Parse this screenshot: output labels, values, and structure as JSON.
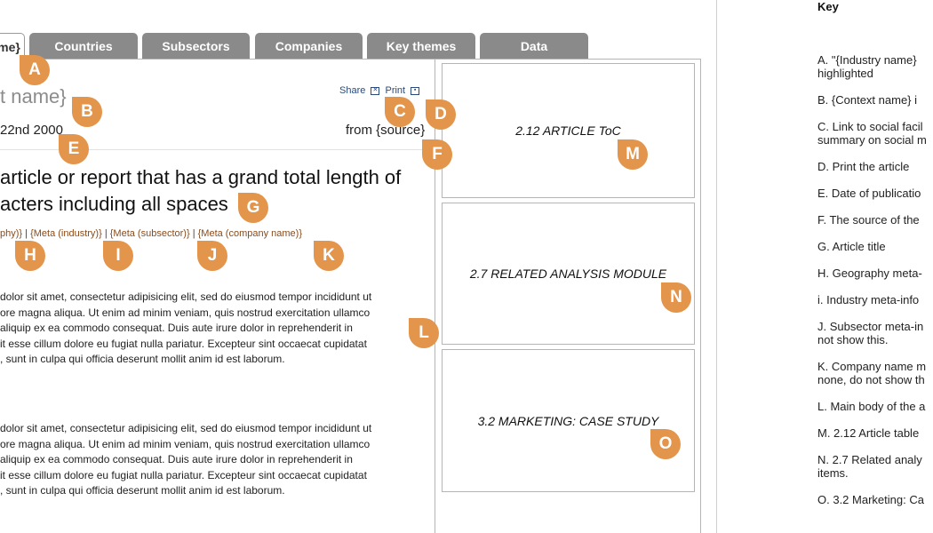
{
  "tabs": [
    {
      "label": "me}",
      "active": true
    },
    {
      "label": "Countries",
      "active": false
    },
    {
      "label": "Subsectors",
      "active": false
    },
    {
      "label": "Companies",
      "active": false
    },
    {
      "label": "Key themes",
      "active": false
    },
    {
      "label": "Data",
      "active": false
    }
  ],
  "article": {
    "context_name": "t name}",
    "date": "22nd 2000",
    "source": "from {source}",
    "share_label": "Share",
    "print_label": "Print",
    "title_lines": [
      "article or report that has a grand total length of",
      "acters including all spaces"
    ],
    "meta": {
      "geography": "phy)}",
      "industry": "{Meta (industry)}",
      "subsector": "{Meta (subsector)}",
      "company": "{Meta (company name)}",
      "separator": "|"
    },
    "paragraphs": [
      [
        "dolor sit amet, consectetur adipisicing elit, sed do eiusmod tempor incididunt ut",
        "ore magna aliqua. Ut enim ad minim veniam, quis nostrud exercitation ullamco",
        "aliquip ex ea commodo consequat. Duis aute irure dolor in reprehenderit in",
        "it esse cillum dolore eu fugiat nulla pariatur. Excepteur sint occaecat cupidatat",
        ", sunt in culpa qui officia deserunt mollit anim id est laborum."
      ],
      [
        "dolor sit amet, consectetur adipisicing elit, sed do eiusmod tempor incididunt ut",
        "ore magna aliqua. Ut enim ad minim veniam, quis nostrud exercitation ullamco",
        "aliquip ex ea commodo consequat. Duis aute irure dolor in reprehenderit in",
        "it esse cillum dolore eu fugiat nulla pariatur. Excepteur sint occaecat cupidatat",
        ", sunt in culpa qui officia deserunt mollit anim id est laborum."
      ]
    ]
  },
  "modules": {
    "toc": "2.12 ARTICLE ToC",
    "related": "2.7 RELATED ANALYSIS MODULE",
    "marketing": "3.2 MARKETING: CASE STUDY"
  },
  "markers": {
    "A": "A",
    "B": "B",
    "C": "C",
    "D": "D",
    "E": "E",
    "F": "F",
    "G": "G",
    "H": "H",
    "I": "I",
    "J": "J",
    "K": "K",
    "L": "L",
    "M": "M",
    "N": "N",
    "O": "O"
  },
  "key": {
    "heading": "Key",
    "items": [
      [
        "A.  \"{Industry name}",
        "highlighted"
      ],
      [
        "B.  {Context name} i"
      ],
      [
        "C.  Link to social facil",
        "summary on social m"
      ],
      [
        "D.  Print the article"
      ],
      [
        "E.  Date of publicatio"
      ],
      [
        "F.  The source of the"
      ],
      [
        "G.  Article title"
      ],
      [
        "H.  Geography meta-"
      ],
      [
        "i.  Industry meta-info"
      ],
      [
        "J.  Subsector meta-in",
        "not show this."
      ],
      [
        "K.  Company name m",
        "none, do not show th"
      ],
      [
        "L.  Main body of the a"
      ],
      [
        "M.  2.12 Article table"
      ],
      [
        "N.  2.7 Related analy",
        "items."
      ],
      [
        "O.  3.2 Marketing: Ca"
      ]
    ]
  },
  "colors": {
    "marker": "#e2954b",
    "tab": "#8a8a8a",
    "meta_text": "#8a4b1a",
    "share_print": "#2a4a7a"
  }
}
